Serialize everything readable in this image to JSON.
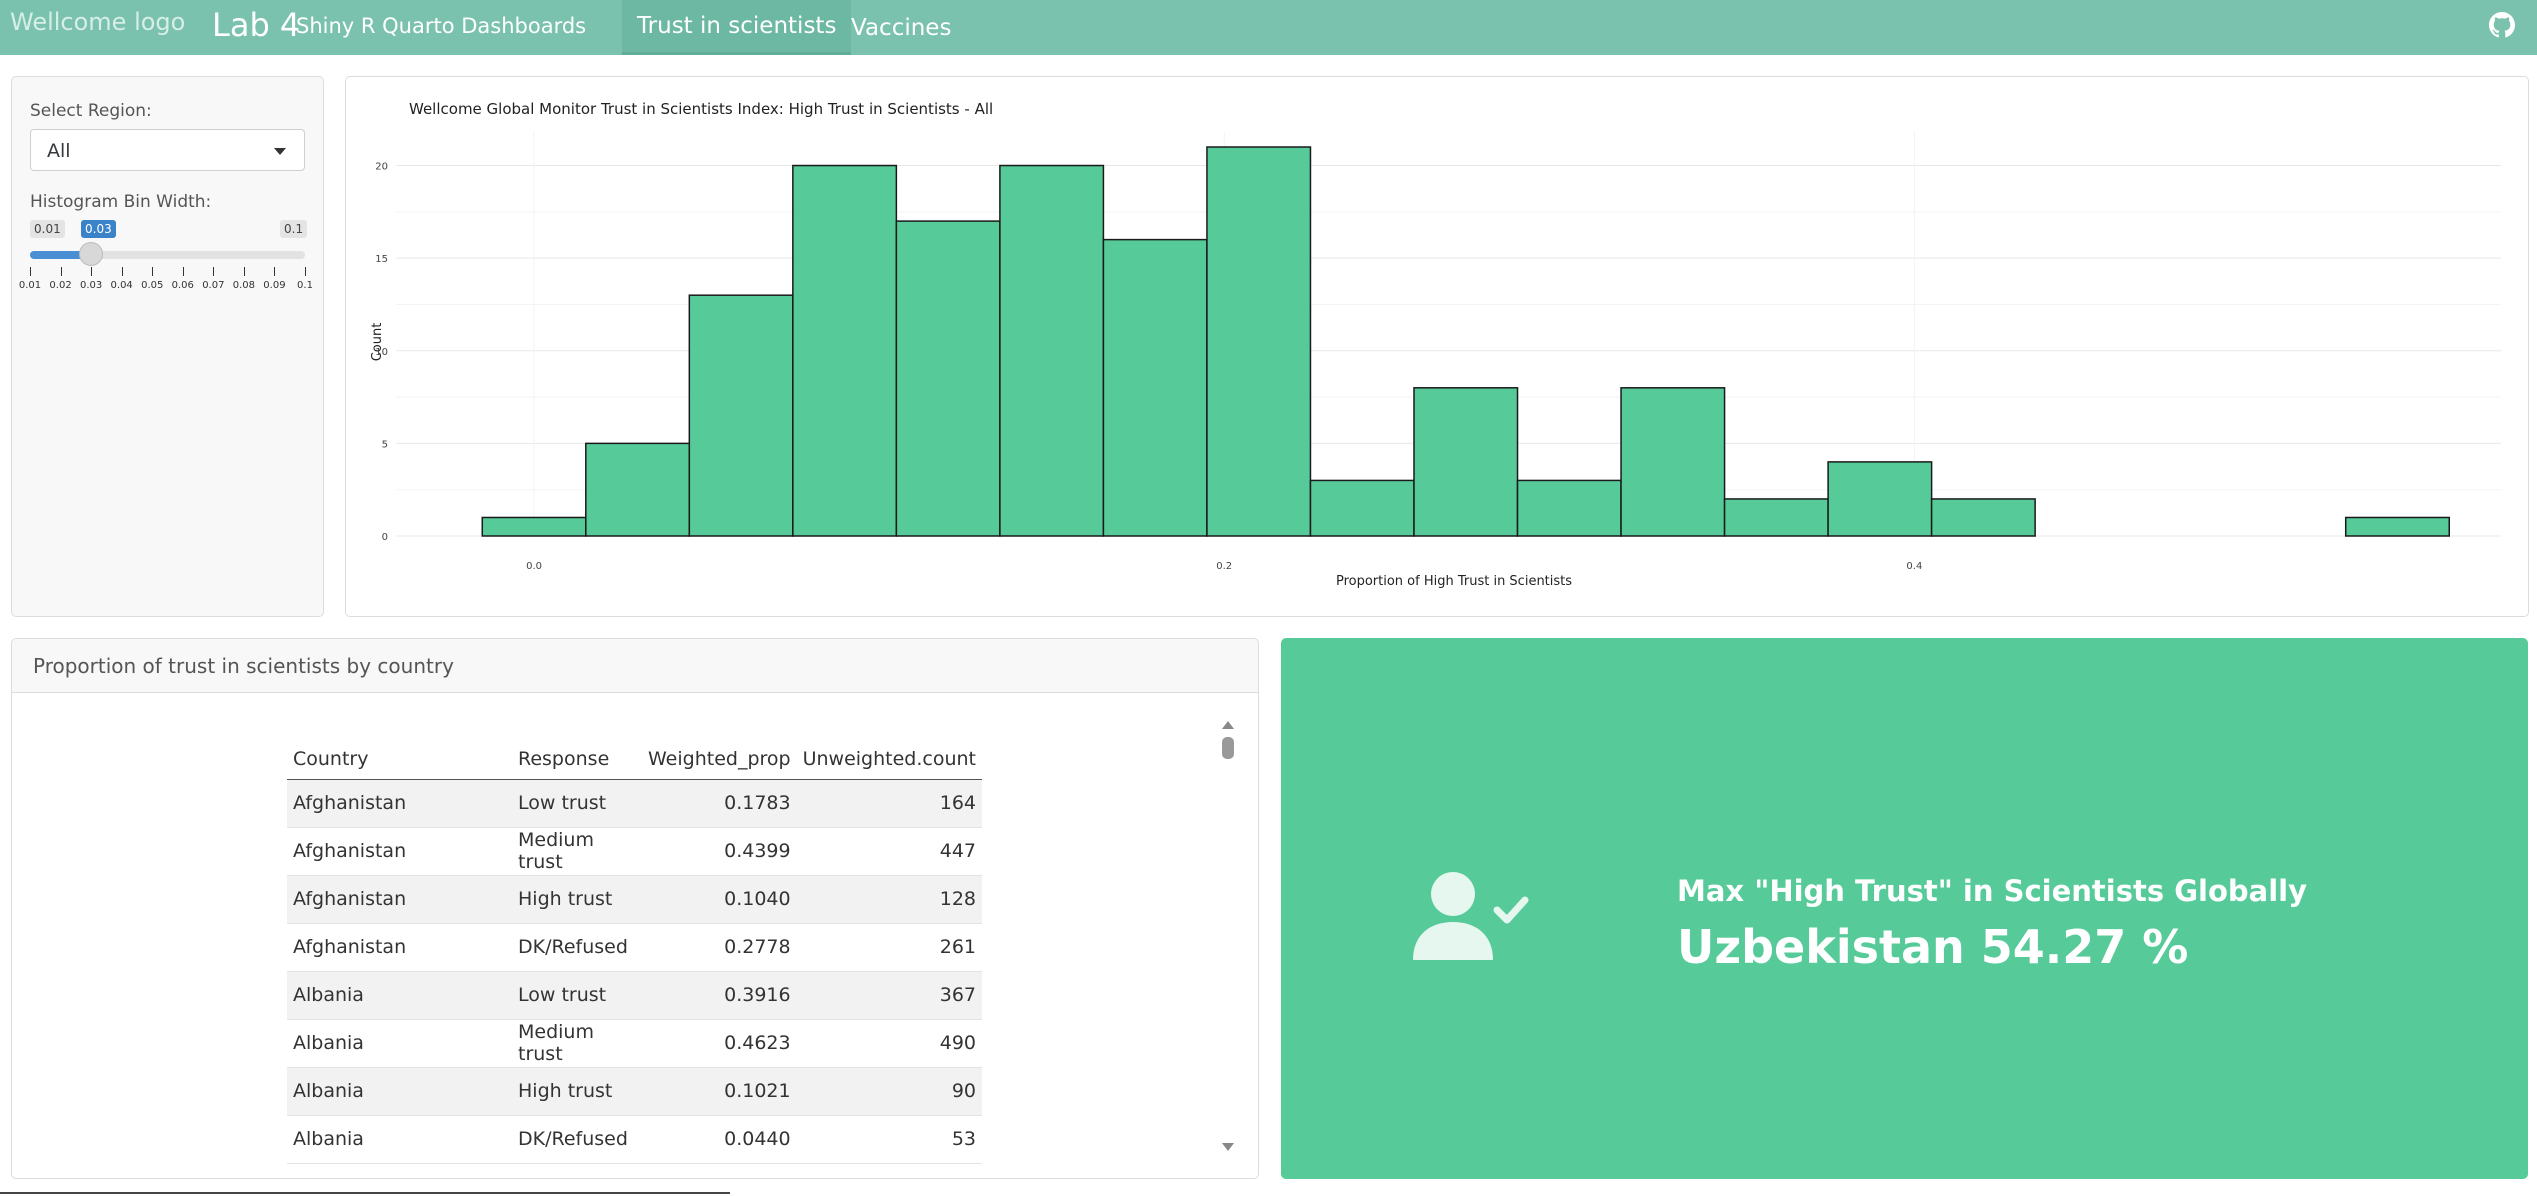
{
  "navbar": {
    "logo_alt": "Wellcome logo",
    "title": "Lab 4",
    "subtitle": "Shiny R Quarto Dashboards",
    "tabs": [
      {
        "label": "Trust in scientists",
        "active": true
      },
      {
        "label": "Vaccines",
        "active": false
      }
    ],
    "github_icon": "github-icon"
  },
  "sidebar": {
    "region_label": "Select Region:",
    "region_value": "All",
    "bin_label": "Histogram Bin Width:",
    "slider": {
      "min_label": "0.01",
      "max_label": "0.1",
      "value_label": "0.03",
      "min": 0.01,
      "max": 0.1,
      "value": 0.03,
      "ticks": [
        "0.01",
        "0.02",
        "0.03",
        "0.04",
        "0.05",
        "0.06",
        "0.07",
        "0.08",
        "0.09",
        "0.1"
      ]
    }
  },
  "chart_data": {
    "type": "bar",
    "title": "Wellcome Global Monitor Trust in Scientists Index: High Trust in Scientists - All",
    "xlabel": "Proportion of High Trust in Scientists",
    "ylabel": "Count",
    "bin_width": 0.03,
    "bins_start": [
      -0.015,
      0.015,
      0.045,
      0.075,
      0.105,
      0.135,
      0.165,
      0.195,
      0.225,
      0.255,
      0.285,
      0.315,
      0.345,
      0.375,
      0.405,
      0.435,
      0.465,
      0.495,
      0.525
    ],
    "values": [
      1,
      5,
      13,
      20,
      17,
      20,
      16,
      21,
      3,
      8,
      3,
      8,
      2,
      4,
      2,
      0,
      0,
      0,
      1
    ],
    "xticks": [
      0.0,
      0.2,
      0.4
    ],
    "xtick_labels": [
      "0.0",
      "0.2",
      "0.4"
    ],
    "yticks": [
      0,
      5,
      10,
      15,
      20
    ],
    "xlim": [
      -0.04,
      0.57
    ],
    "ylim": [
      0,
      21
    ],
    "bar_color": "#56cb99",
    "grid": true
  },
  "table": {
    "title": "Proportion of trust in scientists by country",
    "columns": [
      "Country",
      "Response",
      "Weighted_prop",
      "Unweighted.count"
    ],
    "rows": [
      [
        "Afghanistan",
        "Low trust",
        "0.1783",
        "164"
      ],
      [
        "Afghanistan",
        "Medium trust",
        "0.4399",
        "447"
      ],
      [
        "Afghanistan",
        "High trust",
        "0.1040",
        "128"
      ],
      [
        "Afghanistan",
        "DK/Refused",
        "0.2778",
        "261"
      ],
      [
        "Albania",
        "Low trust",
        "0.3916",
        "367"
      ],
      [
        "Albania",
        "Medium trust",
        "0.4623",
        "490"
      ],
      [
        "Albania",
        "High trust",
        "0.1021",
        "90"
      ],
      [
        "Albania",
        "DK/Refused",
        "0.0440",
        "53"
      ]
    ]
  },
  "value_box": {
    "icon": "user-check-icon",
    "title": "Max \"High Trust\" in Scientists Globally",
    "value": "Uzbekistan 54.27 %",
    "color": "#56cb99"
  }
}
